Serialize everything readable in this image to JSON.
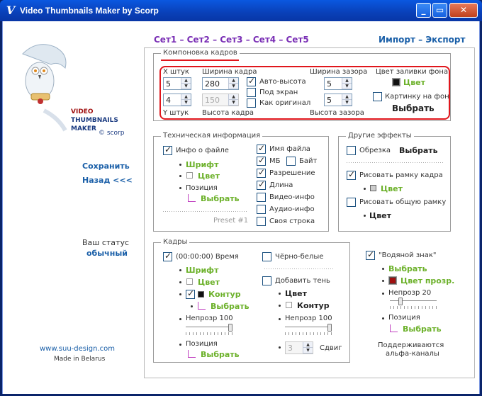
{
  "window": {
    "title": "Video Thumbnails Maker by Scorp",
    "icon": "V"
  },
  "tabs": {
    "set1": "Сет1",
    "set2": "Сет2",
    "set3": "Сет3",
    "set4": "Сет4",
    "set5": "Сет5",
    "sep": "–",
    "import": "Импорт",
    "export": "Экспорт"
  },
  "brand": {
    "line1": "VIDEO",
    "line2": "THUMBNAILS",
    "line3": "MAKER",
    "copyright": "© scorp"
  },
  "side": {
    "save": "Сохранить",
    "back": "Назад <<<",
    "status_label": "Ваш статус",
    "status_value": "обычный",
    "site": "www.suu-design.com",
    "made": "Made in Belarus"
  },
  "layout": {
    "legend": "Компоновка кадров",
    "x_label": "X штук",
    "x_value": "5",
    "y_label": "Y штук",
    "y_value": "4",
    "width_label": "Ширина кадра",
    "width_value": "280",
    "height_label": "Высота кадра",
    "height_value": "150",
    "auto_height": "Авто-высота",
    "fit_screen": "Под экран",
    "as_original": "Как оригинал",
    "gap_width_label": "Ширина зазора",
    "gap_width_value": "5",
    "gap_height_label": "Высота зазора",
    "gap_height_value": "5",
    "bg_color_label": "Цвет заливки фона",
    "bg_color_value": "Цвет",
    "bg_picture": "Картинку на фон",
    "bg_pick": "Выбрать"
  },
  "tech": {
    "legend": "Техническая информация",
    "file_info": "Инфо о файле",
    "font": "Шрифт",
    "color": "Цвет",
    "position": "Позиция",
    "pick": "Выбрать",
    "preset": "Preset #1",
    "file_name": "Имя файла",
    "mb": "МБ",
    "byte": "Байт",
    "resolution": "Разрешение",
    "length": "Длина",
    "video_info": "Видео-инфо",
    "audio_info": "Аудио-инфо",
    "custom_line": "Своя строка"
  },
  "effects": {
    "legend": "Другие эффекты",
    "crop": "Обрезка",
    "crop_pick": "Выбрать",
    "draw_frame_border": "Рисовать рамку кадра",
    "color": "Цвет",
    "draw_total_border": "Рисовать общую рамку"
  },
  "frames": {
    "legend": "Кадры",
    "time": "(00:00:00) Время",
    "font": "Шрифт",
    "color": "Цвет",
    "outline": "Контур",
    "pick": "Выбрать",
    "opacity_label": "Непрозр 100",
    "position": "Позиция",
    "bw": "Чёрно-белые",
    "shadow": "Добавить тень",
    "shadow_color": "Цвет",
    "shadow_outline": "Контур",
    "shadow_opacity_label": "Непрозр 100",
    "shift_label": "Сдвиг",
    "shift_value": "3",
    "opacity_level": 1.0,
    "shadow_opacity_level": 1.0
  },
  "watermark": {
    "label": "\"Водяной знак\"",
    "pick": "Выбрать",
    "transparent_color": "Цвет прозр.",
    "opacity_label": "Непрозр 20",
    "opacity_level": 0.2,
    "position": "Позиция",
    "pick2": "Выбрать",
    "note_line1": "Поддерживаются",
    "note_line2": "альфа-каналы"
  },
  "colors": {
    "titlebar": "#0a4bd0",
    "green": "#6cb12a",
    "blue": "#1a5fa8",
    "highlight": "#e0161c",
    "purple": "#7a2fb5"
  }
}
